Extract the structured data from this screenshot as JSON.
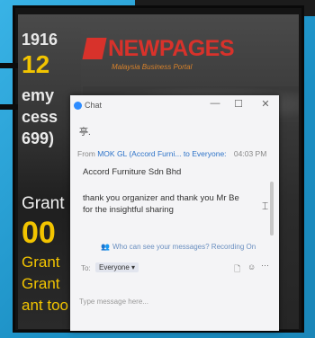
{
  "background_screen": {
    "left_panel": {
      "year": "1916",
      "number": "12",
      "line_a": "emy",
      "line_b": "cess",
      "line_c": "699)",
      "grant_label": "Grant",
      "big_number": "00",
      "grant_line_2": "Grant",
      "grant_line_3": "Grant",
      "grant_line_4": "ant too"
    },
    "banner": {
      "title": "NEWPAGES",
      "subtitle": "Malaysia Business Portal"
    }
  },
  "chat_window": {
    "title": "Chat",
    "window_controls": {
      "minimize": "—",
      "maximize": "☐",
      "close": "✕"
    },
    "top_char": "亭.",
    "message": {
      "from_label": "From",
      "sender": "MOK GL (Accord Furni...",
      "to_label": "to Everyone:",
      "time": "04:03 PM",
      "company": "Accord Furniture Sdn Bhd",
      "text": "thank you organizer and thank you Mr Be for the insightful sharing"
    },
    "privacy_note": "Who can see your messages? Recording On",
    "composer": {
      "to_label": "To:",
      "recipient": "Everyone",
      "placeholder": "Type message here..."
    }
  },
  "colors": {
    "brand_red": "#d8322b",
    "accent_yellow": "#f2c400",
    "link_blue": "#2d73c8",
    "frame_blue": "#2f9fd0"
  }
}
